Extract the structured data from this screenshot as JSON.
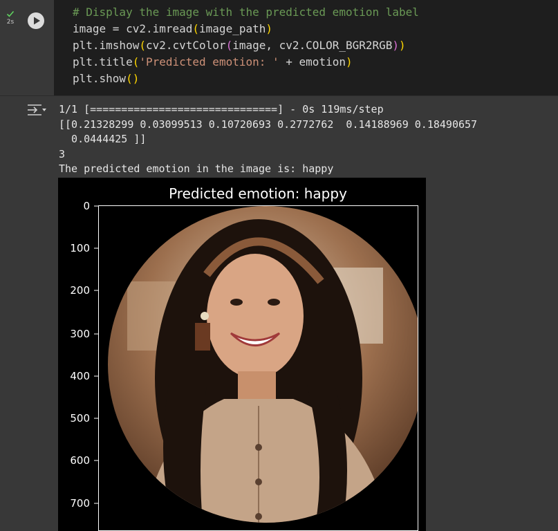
{
  "cell": {
    "exec_time": "2s",
    "code_lines": [
      "# Display the image with the predicted emotion label",
      "image = cv2.imread(image_path)",
      "plt.imshow(cv2.cvtColor(image, cv2.COLOR_BGR2RGB))",
      "plt.title('Predicted emotion: ' + emotion)",
      "plt.show()"
    ],
    "code_tokens": {
      "comment": "# Display the image with the predicted emotion label",
      "l2_pre": "image = cv2.imread",
      "l2_arg": "image_path",
      "l3_pre": "plt.imshow",
      "l3_mid": "cv2.cvtColor",
      "l3_arg": "image, cv2.COLOR_BGR2RGB",
      "l4_pre": "plt.title",
      "l4_str": "'Predicted emotion: '",
      "l4_post": " + emotion",
      "l5_pre": "plt.show",
      "open": "(",
      "close": ")"
    }
  },
  "output": {
    "progress_line": "1/1 [==============================] - 0s 119ms/step",
    "array_line1": "[[0.21328299 0.03099513 0.10720693 0.2772762  0.14188969 0.18490657",
    "array_line2": "  0.0444425 ]]",
    "index_line": "3",
    "result_line": "The predicted emotion in the image is: happy"
  },
  "figure": {
    "title": "Predicted emotion: happy",
    "y_ticks": [
      "0",
      "100",
      "200",
      "300",
      "400",
      "500",
      "600",
      "700"
    ],
    "image_description_icon": "photo-of-smiling-woman"
  },
  "colors": {
    "background": "#383838",
    "code_bg": "#1e1e1e",
    "comment": "#6a9955",
    "string": "#ce9178",
    "bracket1": "#ffd700",
    "bracket2": "#da70d6",
    "check": "#5fd35f"
  }
}
